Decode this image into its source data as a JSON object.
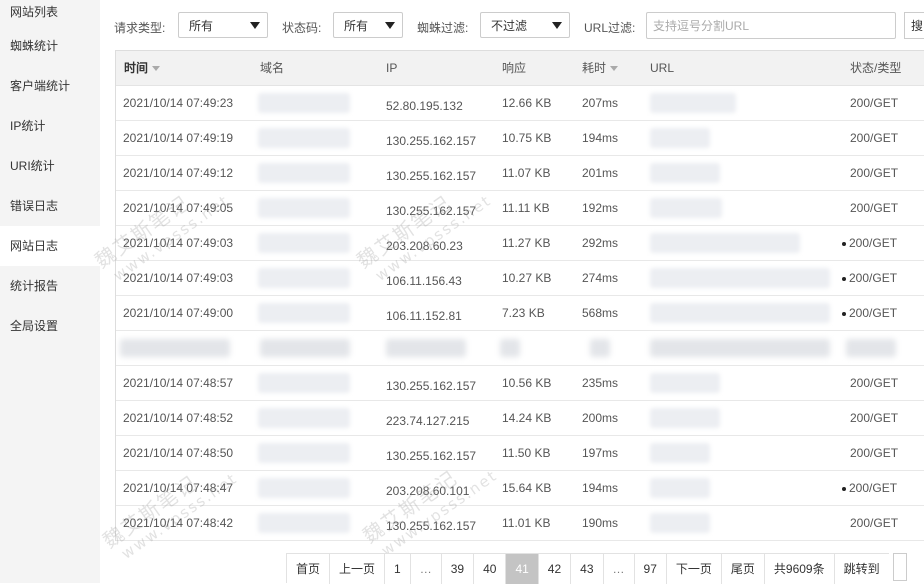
{
  "sidebar": {
    "items": [
      {
        "label": "网站列表"
      },
      {
        "label": "蜘蛛统计"
      },
      {
        "label": "客户端统计"
      },
      {
        "label": "IP统计"
      },
      {
        "label": "URI统计"
      },
      {
        "label": "错误日志"
      },
      {
        "label": "网站日志",
        "active": true
      },
      {
        "label": "统计报告"
      },
      {
        "label": "全局设置"
      }
    ]
  },
  "filters": {
    "request_type_label": "请求类型:",
    "request_type_value": "所有",
    "status_code_label": "状态码:",
    "status_code_value": "所有",
    "spider_filter_label": "蜘蛛过滤:",
    "spider_filter_value": "不过滤",
    "url_filter_label": "URL过滤:",
    "url_filter_placeholder": "支持逗号分割URL",
    "search_label": "搜"
  },
  "table": {
    "headers": {
      "time": "时间",
      "domain": "域名",
      "ip": "IP",
      "response": "响应",
      "duration": "耗时",
      "url": "URL",
      "status": "状态/类型"
    },
    "rows": [
      {
        "time": "2021/10/14 07:49:23",
        "ip": "52.80.195.132",
        "response": "12.66 KB",
        "duration": "207ms",
        "status": "200/GET",
        "dot": false
      },
      {
        "time": "2021/10/14 07:49:19",
        "ip": "130.255.162.157",
        "response": "10.75 KB",
        "duration": "194ms",
        "status": "200/GET",
        "dot": false
      },
      {
        "time": "2021/10/14 07:49:12",
        "ip": "130.255.162.157",
        "response": "11.07 KB",
        "duration": "201ms",
        "status": "200/GET",
        "dot": false
      },
      {
        "time": "2021/10/14 07:49:05",
        "ip": "130.255.162.157",
        "response": "11.11 KB",
        "duration": "192ms",
        "status": "200/GET",
        "dot": false
      },
      {
        "time": "2021/10/14 07:49:03",
        "ip": "203.208.60.23",
        "response": "11.27 KB",
        "duration": "292ms",
        "status": "200/GET",
        "dot": true
      },
      {
        "time": "2021/10/14 07:49:03",
        "ip": "106.11.156.43",
        "response": "10.27 KB",
        "duration": "274ms",
        "status": "200/GET",
        "dot": true
      },
      {
        "time": "2021/10/14 07:49:00",
        "ip": "106.11.152.81",
        "response": "7.23 KB",
        "duration": "568ms",
        "status": "200/GET",
        "dot": true
      },
      {
        "masked": true
      },
      {
        "time": "2021/10/14 07:48:57",
        "ip": "130.255.162.157",
        "response": "10.56 KB",
        "duration": "235ms",
        "status": "200/GET",
        "dot": false
      },
      {
        "time": "2021/10/14 07:48:52",
        "ip": "223.74.127.215",
        "response": "14.24 KB",
        "duration": "200ms",
        "status": "200/GET",
        "dot": false
      },
      {
        "time": "2021/10/14 07:48:50",
        "ip": "130.255.162.157",
        "response": "11.50 KB",
        "duration": "197ms",
        "status": "200/GET",
        "dot": false
      },
      {
        "time": "2021/10/14 07:48:47",
        "ip": "203.208.60.101",
        "response": "15.64 KB",
        "duration": "194ms",
        "status": "200/GET",
        "dot": true
      },
      {
        "time": "2021/10/14 07:48:42",
        "ip": "130.255.162.157",
        "response": "11.01 KB",
        "duration": "190ms",
        "status": "200/GET",
        "dot": false
      }
    ]
  },
  "pagination": {
    "first": "首页",
    "prev": "上一页",
    "pages": [
      "1",
      "…",
      "39",
      "40",
      "41",
      "42",
      "43",
      "…",
      "97"
    ],
    "current": "41",
    "next": "下一页",
    "last": "尾页",
    "total": "共9609条",
    "jump_label": "跳转到"
  },
  "watermark": {
    "text": "魏艾斯笔记",
    "url": "www.vpsss.net"
  }
}
